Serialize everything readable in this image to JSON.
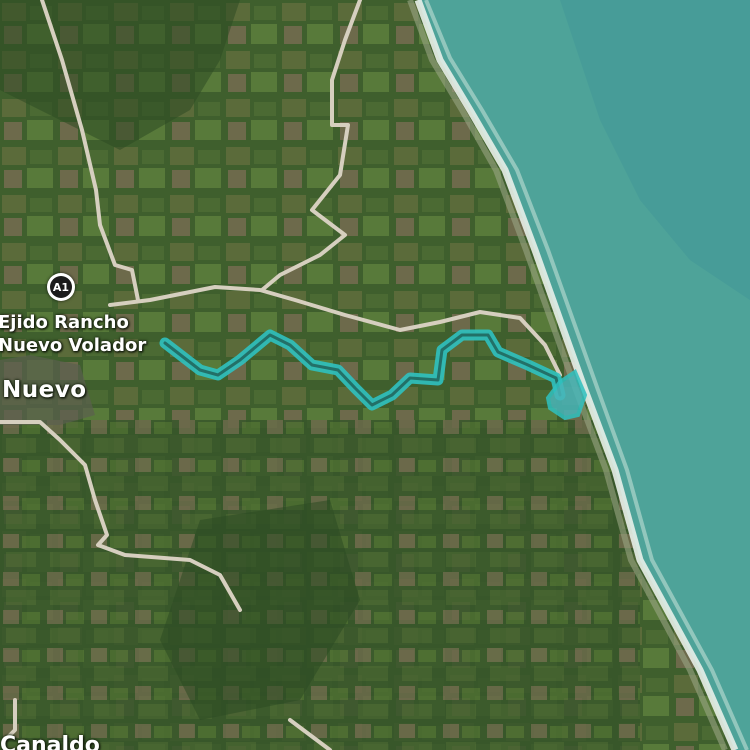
{
  "map": {
    "type": "satellite",
    "colors": {
      "land": "#3d5a2c",
      "sea": "#4ea399",
      "surf": "#e8efe9",
      "road": "#d6cfbf",
      "route": "#2fc1c0"
    }
  },
  "labels": {
    "place_line1": "Ejido Rancho",
    "place_line2": "Nuevo Volador",
    "town": "Nuevo",
    "bottom_cut": "Canaldo"
  },
  "marker": {
    "text": "A1",
    "icon": "map-pin-icon"
  }
}
